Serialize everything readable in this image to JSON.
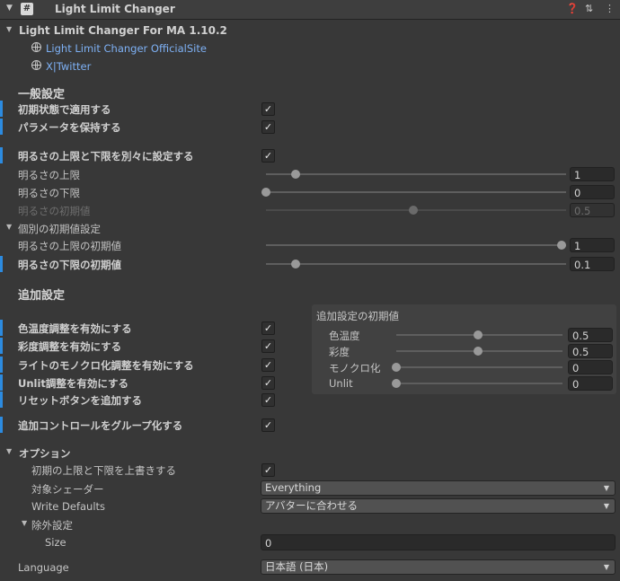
{
  "header": {
    "title": "Light Limit Changer",
    "collapse_icon": "fold-triangle-icon",
    "component_icon": "script-hash-icon",
    "tools": [
      "help-icon",
      "preset-sliders-icon",
      "kebab-menu-icon"
    ]
  },
  "foldout_title": "Light Limit Changer For MA 1.10.2",
  "links": [
    "Light Limit Changer OfficialSite",
    "X|Twitter"
  ],
  "general": {
    "title": "一般設定",
    "apply_initial": {
      "label": "初期状態で適用する",
      "checked": true
    },
    "save_params": {
      "label": "パラメータを保持する",
      "checked": true
    },
    "separate_limits": {
      "label": "明るさの上限と下限を別々に設定する",
      "checked": true
    },
    "max_brightness": {
      "label": "明るさの上限",
      "value": "1",
      "fraction": 0.1
    },
    "min_brightness": {
      "label": "明るさの下限",
      "value": "0",
      "fraction": 0.0
    },
    "default_brightness": {
      "label": "明るさの初期値",
      "value": "0.5",
      "fraction": 0.5,
      "disabled": true
    }
  },
  "individual": {
    "title": "個別の初期値設定",
    "upper": {
      "label": "明るさの上限の初期値",
      "value": "1",
      "fraction": 1.0
    },
    "lower": {
      "label": "明るさの下限の初期値",
      "value": "0.1",
      "fraction": 0.1
    }
  },
  "additional": {
    "title": "追加設定",
    "items": [
      {
        "label": "色温度調整を有効にする",
        "checked": true
      },
      {
        "label": "彩度調整を有効にする",
        "checked": true
      },
      {
        "label": "ライトのモノクロ化調整を有効にする",
        "checked": true
      },
      {
        "label": "Unlit調整を有効にする",
        "checked": true
      },
      {
        "label": "リセットボタンを追加する",
        "checked": true
      }
    ],
    "group": {
      "label": "追加コントロールをグループ化する",
      "checked": true
    },
    "defaults": {
      "title": "追加設定の初期値",
      "items": [
        {
          "label": "色温度",
          "value": "0.5",
          "fraction": 0.5
        },
        {
          "label": "彩度",
          "value": "0.5",
          "fraction": 0.5
        },
        {
          "label": "モノクロ化",
          "value": "0",
          "fraction": 0.0
        },
        {
          "label": "Unlit",
          "value": "0",
          "fraction": 0.0
        }
      ]
    }
  },
  "options": {
    "title": "オプション",
    "override": {
      "label": "初期の上限と下限を上書きする",
      "checked": true
    },
    "shader": {
      "label": "対象シェーダー",
      "value": "Everything"
    },
    "write_defaults": {
      "label": "Write Defaults",
      "value": "アバターに合わせる"
    },
    "exclusion": {
      "title": "除外設定",
      "size_label": "Size",
      "size_value": "0"
    }
  },
  "language": {
    "label": "Language",
    "value": "日本語 (日本)"
  },
  "colors": {
    "background": "#383838",
    "accent_marker": "#2c8be0",
    "link": "#7eb1f5"
  }
}
